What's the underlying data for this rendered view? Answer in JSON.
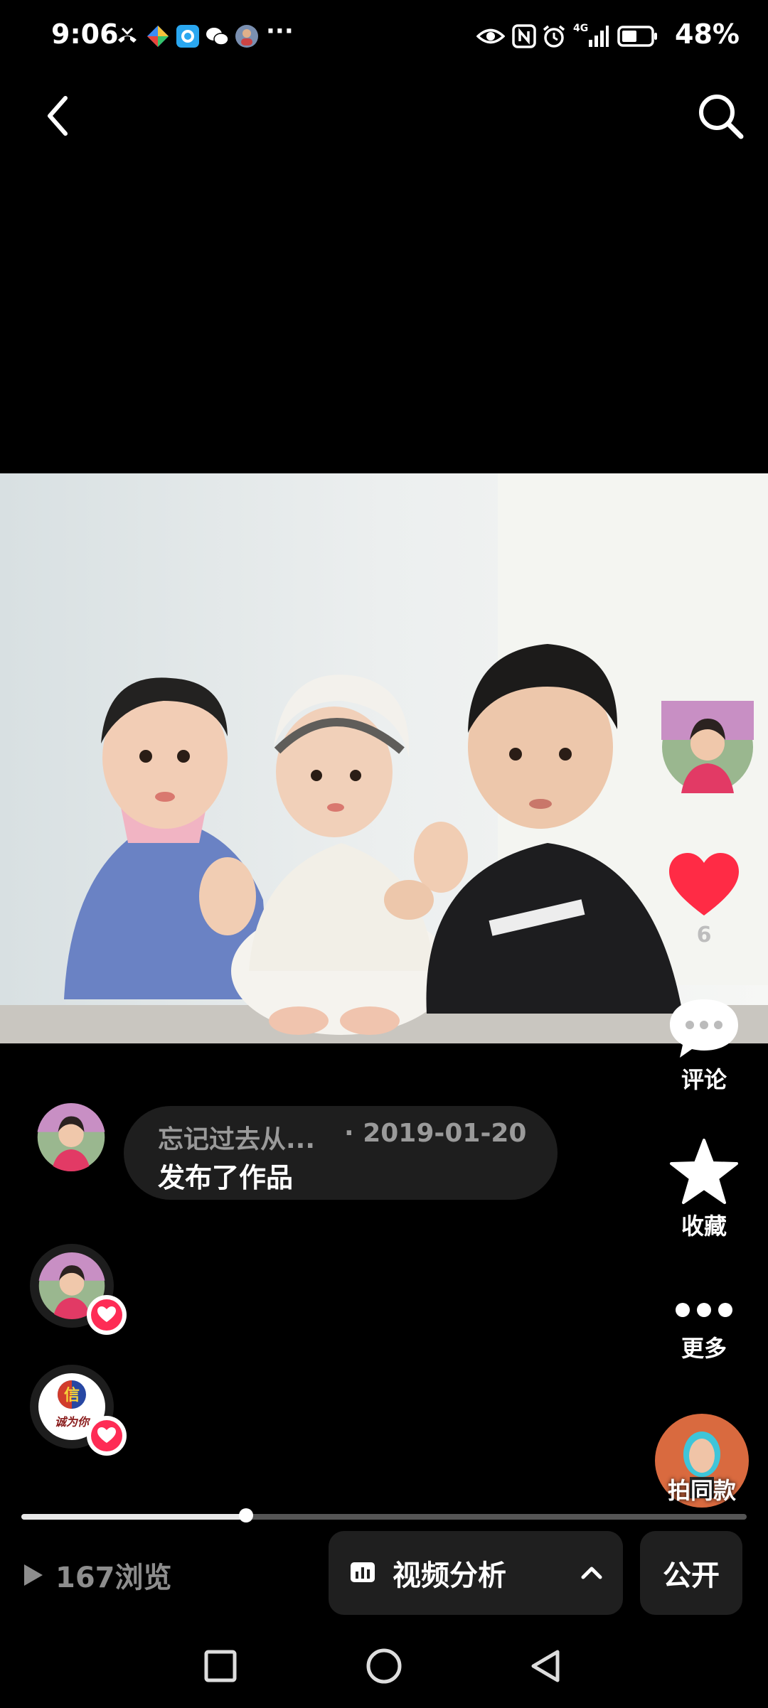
{
  "status_bar": {
    "time": "9:06",
    "battery_pct": "48%",
    "overflow": "···",
    "network": "4G"
  },
  "post": {
    "author": "忘记过去从...",
    "date": "· 2019-01-20",
    "action": "发布了作品"
  },
  "rail": {
    "likes": "6",
    "comment_label": "评论",
    "favorite_label": "收藏",
    "more_label": "更多",
    "same_style_label": "拍同款"
  },
  "progress": {
    "fraction": 0.31
  },
  "bottom": {
    "views": "167浏览",
    "analysis_label": "视频分析",
    "public_label": "公开"
  },
  "liker_logo_text": "信 诚为你",
  "colors": {
    "accent_red": "#fe2c55",
    "like_heart": "#ff2b45",
    "bubble_bg": "#1e1e1e"
  }
}
